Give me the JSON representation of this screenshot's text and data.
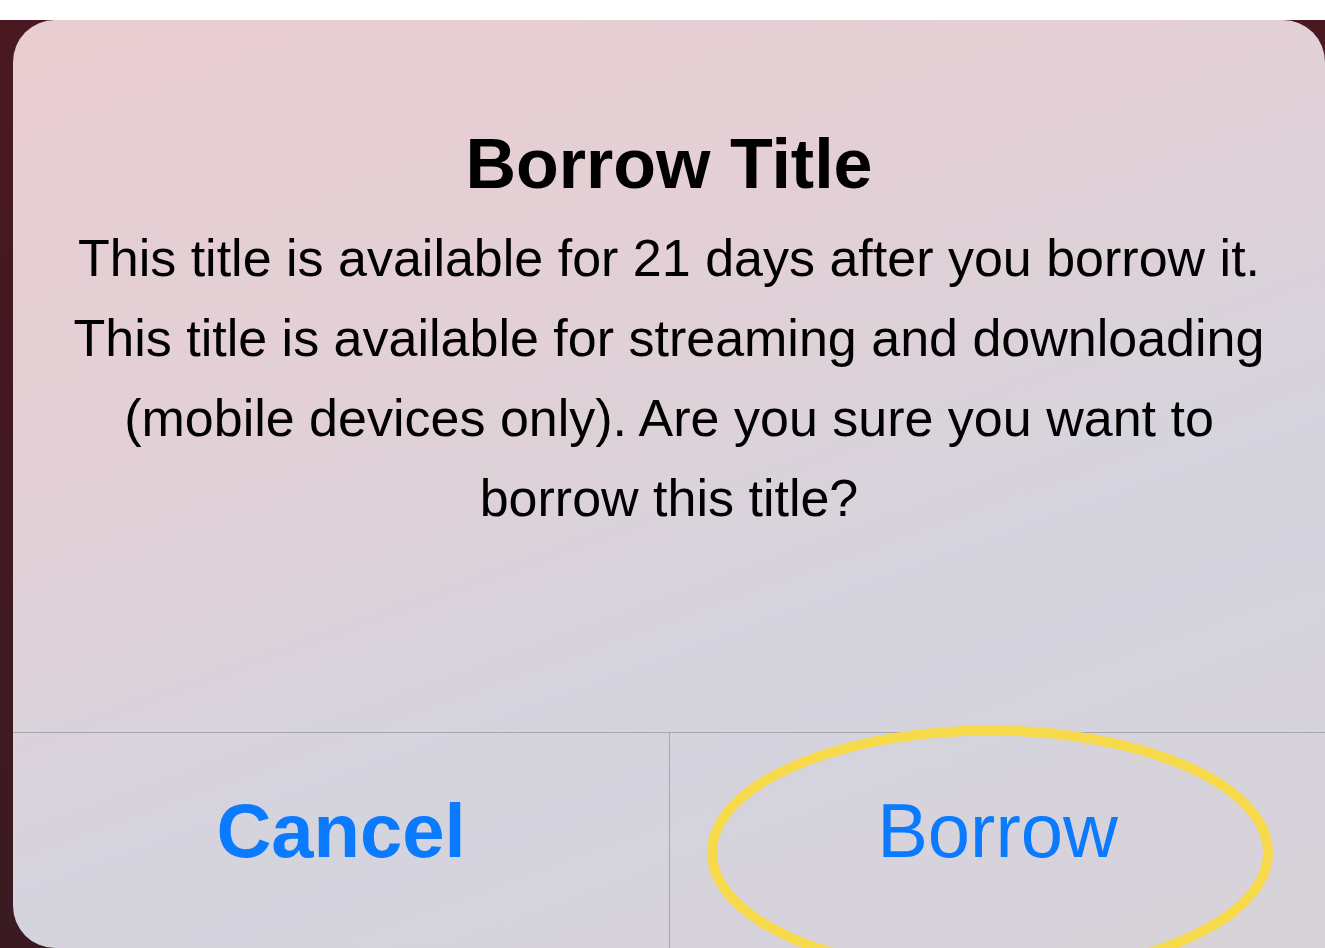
{
  "alert": {
    "title": "Borrow Title",
    "message": "This title is available for 21 days after you borrow it.  This title is available for streaming and downloading (mobile devices only). Are you sure you want to borrow this title?",
    "buttons": [
      {
        "label": "Cancel",
        "bold": true,
        "highlighted": false
      },
      {
        "label": "Borrow",
        "bold": false,
        "highlighted": true
      }
    ]
  }
}
